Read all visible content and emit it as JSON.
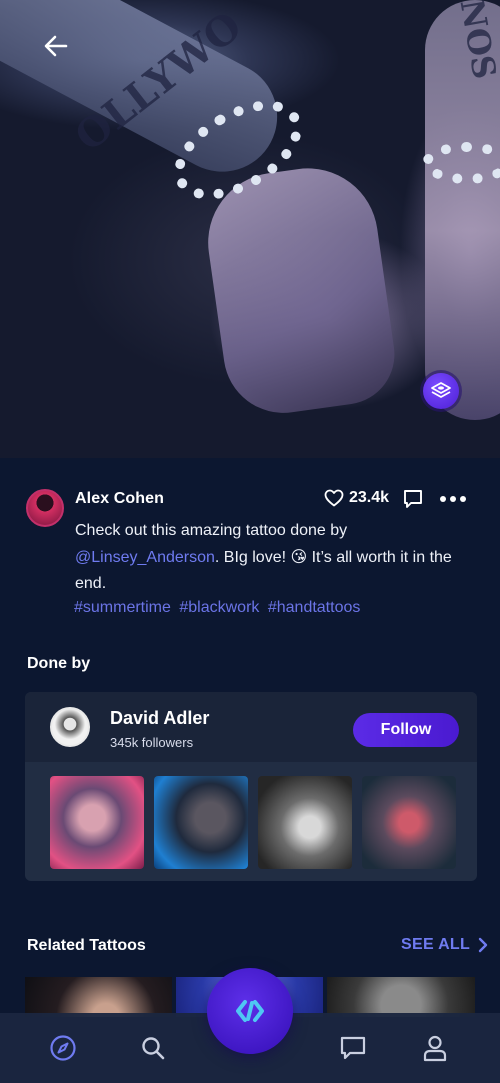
{
  "post": {
    "author": "Alex Cohen",
    "likes": "23.4k",
    "caption_before": "Check out this amazing tattoo done by ",
    "mention": "@Linsey_Anderson",
    "caption_after": ". BIg love! 😘 It’s all worth it in the end.",
    "hashtags": [
      "#summertime",
      "#blackwork",
      "#handtattoos"
    ]
  },
  "done_by": {
    "title": "Done by",
    "artist_name": "David Adler",
    "followers": "345k followers",
    "follow_label": "Follow"
  },
  "related": {
    "title": "Related Tattoos",
    "see_all": "SEE ALL"
  },
  "hero_tattoo_text": {
    "left_arm": "OLLYWO",
    "right_arm": "NOS"
  },
  "icons": {
    "back": "arrow-left-icon",
    "ar": "ar-scan-icon",
    "like": "heart-icon",
    "comment": "comment-icon",
    "more": "more-horizontal-icon",
    "see_all": "chevron-right-icon",
    "nav": [
      "compass-icon",
      "search-icon",
      "app-logo-icon",
      "chat-icon",
      "profile-icon"
    ]
  },
  "colors": {
    "background": "#0c1730",
    "card": "#212d43",
    "accent": "#5b2be6",
    "link": "#6f7bf0",
    "nav_active": "#6f7bf0"
  }
}
